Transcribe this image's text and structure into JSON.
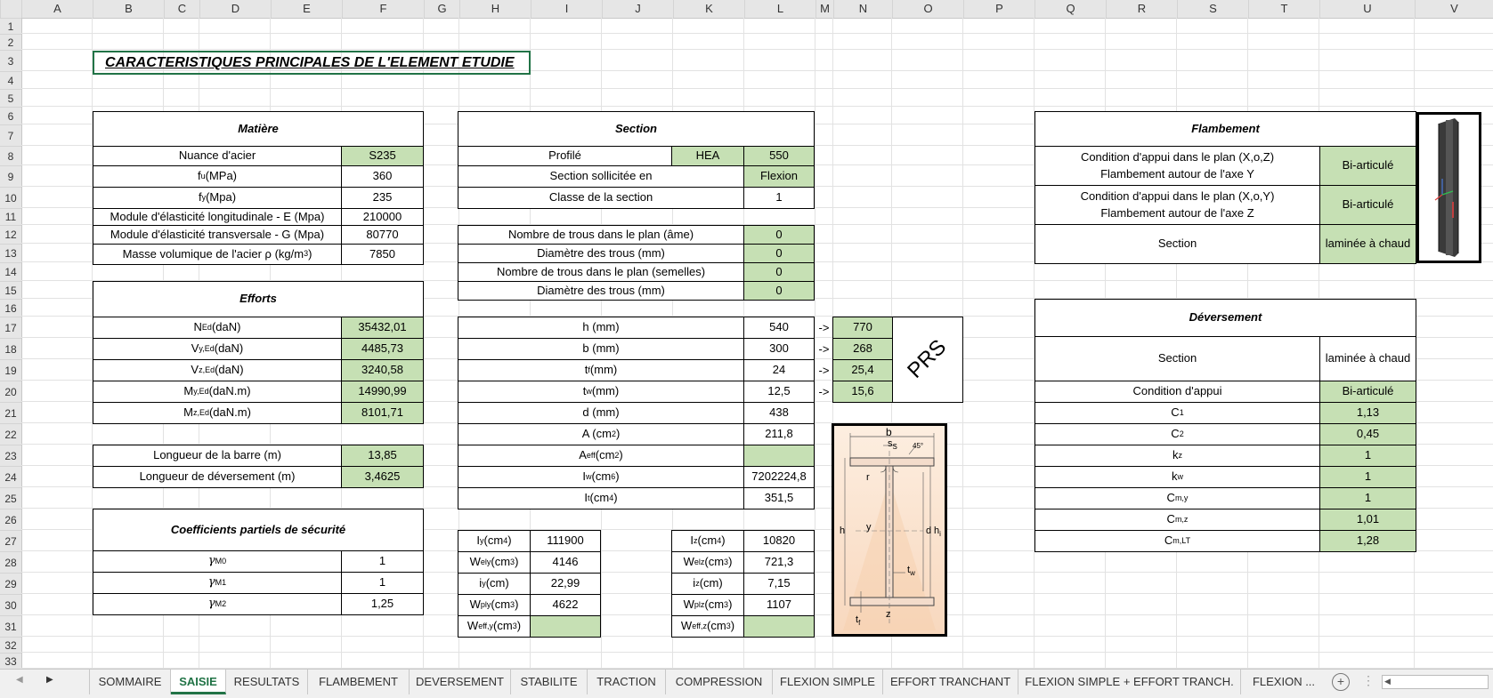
{
  "columns": [
    "A",
    "B",
    "C",
    "D",
    "E",
    "F",
    "G",
    "H",
    "I",
    "J",
    "K",
    "L",
    "M",
    "N",
    "O",
    "P",
    "Q",
    "R",
    "S",
    "T",
    "U",
    "V"
  ],
  "rows": [
    "1",
    "2",
    "3",
    "4",
    "5",
    "6",
    "7",
    "8",
    "9",
    "10",
    "11",
    "12",
    "13",
    "14",
    "15",
    "16",
    "17",
    "18",
    "19",
    "20",
    "21",
    "22",
    "23",
    "24",
    "25",
    "26",
    "27",
    "28",
    "29",
    "30",
    "31",
    "32",
    "33"
  ],
  "title": "CARACTERISTIQUES PRINCIPALES DE L'ELEMENT ETUDIE",
  "matiere": {
    "header": "Matière",
    "nuance_label": "Nuance d'acier",
    "nuance": "S235",
    "fu_label": "f",
    "fu_sub": "u",
    "fu_unit": " (MPa)",
    "fu": "360",
    "fy_label": "f",
    "fy_sub": "y",
    "fy_unit": " (Mpa)",
    "fy": "235",
    "E_label": "Module d'élasticité longitudinale - E (Mpa)",
    "E": "210000",
    "G_label": "Module d'élasticité transversale - G (Mpa)",
    "G": "80770",
    "rho_label": "Masse volumique de l'acier ρ (kg/m",
    "rho_sup": "3",
    "rho_end": ")",
    "rho": "7850"
  },
  "efforts": {
    "header": "Efforts",
    "NEd_l": "N",
    "NEd_s": "Ed",
    "NEd_u": " (daN)",
    "NEd": "35432,01",
    "VyEd_l": "V",
    "VyEd_s": "y,Ed",
    "VyEd_u": " (daN)",
    "VyEd": "4485,73",
    "VzEd_l": "V",
    "VzEd_s": "z,Ed",
    "VzEd_u": " (daN)",
    "VzEd": "3240,58",
    "MyEd_l": "M",
    "MyEd_s": "y,Ed",
    "MyEd_u": " (daN.m)",
    "MyEd": "14990,99",
    "MzEd_l": "M",
    "MzEd_s": "z,Ed",
    "MzEd_u": " (daN.m)",
    "MzEd": "8101,71"
  },
  "longueurs": {
    "barre_label": "Longueur de la barre (m)",
    "barre": "13,85",
    "dev_label": "Longueur de déversement (m)",
    "dev": "3,4625"
  },
  "coef": {
    "header": "Coefficients partiels de sécurité",
    "g0_l": "γ",
    "g0_s": "M0",
    "g0": "1",
    "g1_l": "γ",
    "g1_s": "M1",
    "g1": "1",
    "g2_l": "γ",
    "g2_s": "M2",
    "g2": "1,25"
  },
  "section": {
    "header": "Section",
    "profile_label": "Profilé",
    "profile_type": "HEA",
    "profile_size": "550",
    "sollicitee_label": "Section sollicitée en",
    "sollicitee": "Flexion",
    "classe_label": "Classe de la section",
    "classe": "1",
    "trous_ame_label": "Nombre de trous dans le plan (âme)",
    "trous_ame": "0",
    "diam1_label": "Diamètre des trous (mm)",
    "diam1": "0",
    "trous_sem_label": "Nombre de trous dans le plan (semelles)",
    "trous_sem": "0",
    "diam2_label": "Diamètre des trous (mm)",
    "diam2": "0"
  },
  "geom": {
    "h_label": "h (mm)",
    "h": "540",
    "h_prs": "770",
    "b_label": "b (mm)",
    "b": "300",
    "b_prs": "268",
    "tf_l": "t",
    "tf_s": "f",
    "tf_u": " (mm)",
    "tf": "24",
    "tf_prs": "25,4",
    "tw_l": "t",
    "tw_s": "w",
    "tw_u": " (mm)",
    "tw": "12,5",
    "tw_prs": "15,6",
    "d_label": "d (mm)",
    "d": "438",
    "A_l": "A (cm",
    "A_sup": "2",
    "A_e": ")",
    "A": "211,8",
    "Aeff_l": "A",
    "Aeff_s": "eff",
    "Aeff_u": " (cm",
    "Aeff_sup": "2",
    "Aeff_e": ")",
    "Aeff": "",
    "Iw_l": "I",
    "Iw_s": "w",
    "Iw_u": " (cm",
    "Iw_sup": "6",
    "Iw_e": ")",
    "Iw": "7202224,8",
    "It_l": "I",
    "It_s": "t",
    "It_u": " (cm",
    "It_sup": "4",
    "It_e": ")",
    "It": "351,5",
    "arrow": "->",
    "prs": "PRS"
  },
  "props_y": {
    "Iy_l": "I",
    "Iy_s": "y",
    "Iy_u": " (cm",
    "Iy_sup": "4",
    "Iy_e": ")",
    "Iy": "111900",
    "Wely_l": "W",
    "Wely_s": "ely",
    "Wely_u": " (cm",
    "Wely_sup": "3",
    "Wely_e": ")",
    "Wely": "4146",
    "iy_l": "i",
    "iy_s": "y",
    "iy_u": " (cm)",
    "iy": "22,99",
    "Wply_l": "W",
    "Wply_s": "ply",
    "Wply_u": " (cm",
    "Wply_sup": "3",
    "Wply_e": ")",
    "Wply": "4622",
    "Weffy_l": "W",
    "Weffy_s": "eff,y",
    "Weffy_u": " (cm",
    "Weffy_sup": "3",
    "Weffy_e": ")",
    "Weffy": ""
  },
  "props_z": {
    "Iz_l": "I",
    "Iz_s": "z",
    "Iz_u": " (cm",
    "Iz_sup": "4",
    "Iz_e": ")",
    "Iz": "10820",
    "Welz_l": "W",
    "Welz_s": "elz",
    "Welz_u": " (cm",
    "Welz_sup": "3",
    "Welz_e": ")",
    "Welz": "721,3",
    "iz_l": "i",
    "iz_s": "z",
    "iz_u": " (cm)",
    "iz": "7,15",
    "Wplz_l": "W",
    "Wplz_s": "plz",
    "Wplz_u": " (cm",
    "Wplz_sup": "3",
    "Wplz_e": ")",
    "Wplz": "1107",
    "Weffz_l": "W",
    "Weffz_s": "eff,z",
    "Weffz_u": " (cm",
    "Weffz_sup": "3",
    "Weffz_e": ")",
    "Weffz": ""
  },
  "flambement": {
    "header": "Flambement",
    "cond_y_1": "Condition d'appui dans le plan (X,o,Z)",
    "cond_y_2": "Flambement autour de l'axe Y",
    "cond_y": "Bi-articulé",
    "cond_z_1": "Condition d'appui dans le plan (X,o,Y)",
    "cond_z_2": "Flambement autour de l'axe Z",
    "cond_z": "Bi-articulé",
    "section_label": "Section",
    "section": "laminée à chaud"
  },
  "deversement": {
    "header": "Déversement",
    "section_label": "Section",
    "section": "laminée à chaud",
    "cond_label": "Condition d'appui",
    "cond": "Bi-articulé",
    "C1_l": "C",
    "C1_s": "1",
    "C1": "1,13",
    "C2_l": "C",
    "C2_s": "2",
    "C2": "0,45",
    "kz_l": "k",
    "kz_s": "z",
    "kz": "1",
    "kw_l": "k",
    "kw_s": "w",
    "kw": "1",
    "Cmy_l": "C",
    "Cmy_s": "m,y",
    "Cmy": "1",
    "Cmz_l": "C",
    "Cmz_s": "m,z",
    "Cmz": "1,01",
    "CmLT_l": "C",
    "CmLT_s": "m,LT",
    "CmLT": "1,28"
  },
  "diagram": {
    "b": "b",
    "ss": "s",
    "ss_sub": "S",
    "angle": "45°",
    "r": "r",
    "h": "h",
    "y": "y",
    "d": "d",
    "hi": "h",
    "hi_sub": "i",
    "tw": "t",
    "tw_sub": "w",
    "tf": "t",
    "tf_sub": "f",
    "z": "z"
  },
  "tabs": [
    "SOMMAIRE",
    "SAISIE",
    "RESULTATS",
    "FLAMBEMENT",
    "DEVERSEMENT",
    "STABILITE",
    "TRACTION",
    "COMPRESSION",
    "FLEXION SIMPLE",
    "EFFORT TRANCHANT",
    "FLEXION SIMPLE + EFFORT TRANCH.",
    "FLEXION ..."
  ],
  "active_tab": "SAISIE",
  "colors": {
    "green_fill": "#c6e0b4",
    "excel_green": "#217346"
  }
}
